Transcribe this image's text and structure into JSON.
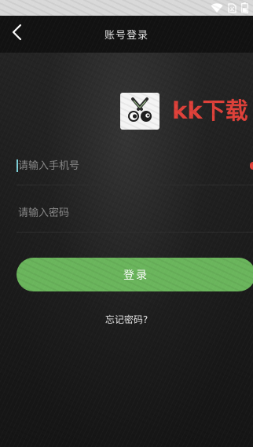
{
  "status_bar": {
    "icons": [
      "wifi-icon",
      "sim-icon",
      "battery-icon"
    ]
  },
  "header": {
    "back_icon": "chevron-left-icon",
    "title": "账号登录"
  },
  "logo": {
    "icon": "scissors-eyes-logo",
    "brand_text": "kk下载"
  },
  "form": {
    "phone": {
      "value": "",
      "placeholder": "请输入手机号"
    },
    "password": {
      "value": "",
      "placeholder": "请输入密码"
    },
    "login_label": "登录",
    "forgot_label": "忘记密码?"
  },
  "colors": {
    "background": "#1b1b1b",
    "title_bar": "#121212",
    "status_bar": "#d9d9d9",
    "accent_green": "#6ab55c",
    "brand_red": "#e0413a",
    "cursor": "#7fd0d8"
  }
}
